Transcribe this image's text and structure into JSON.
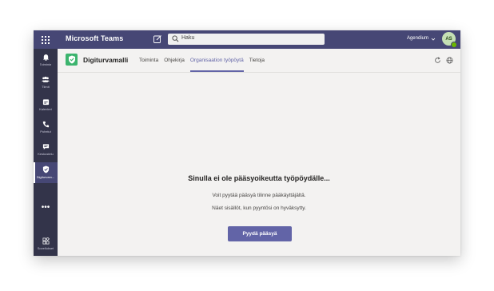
{
  "titlebar": {
    "app_title": "Microsoft Teams",
    "search_placeholder": "Haku",
    "org_name": "Agendium",
    "avatar_initials": "AS",
    "bg_color": "#464775"
  },
  "rail": {
    "items": [
      {
        "label": "Toiminta",
        "icon": "bell-icon"
      },
      {
        "label": "Tiimit",
        "icon": "teams-icon"
      },
      {
        "label": "Kalenteri",
        "icon": "calendar-icon"
      },
      {
        "label": "Puhelut",
        "icon": "phone-icon"
      },
      {
        "label": "Keskustelu",
        "icon": "chat-icon"
      },
      {
        "label": "Digiturvam...",
        "icon": "shield-icon",
        "active": true
      }
    ],
    "more": "•••",
    "apps_label": "Sovellukset"
  },
  "app_header": {
    "app_name": "Digiturvamalli",
    "tabs": [
      {
        "label": "Toiminta"
      },
      {
        "label": "Ohjekirja"
      },
      {
        "label": "Organisaation työpöytä",
        "active": true
      },
      {
        "label": "Tietoja"
      }
    ],
    "accent_color": "#6264a7"
  },
  "main": {
    "heading": "Sinulla ei ole pääsyoikeutta työpöydälle...",
    "line1": "Voit pyytää pääsyä tilinne pääkäyttäjältä.",
    "line2": "Näet sisällöt, kun pyyntösi on hyväksytty.",
    "button_label": "Pyydä pääsyä"
  }
}
